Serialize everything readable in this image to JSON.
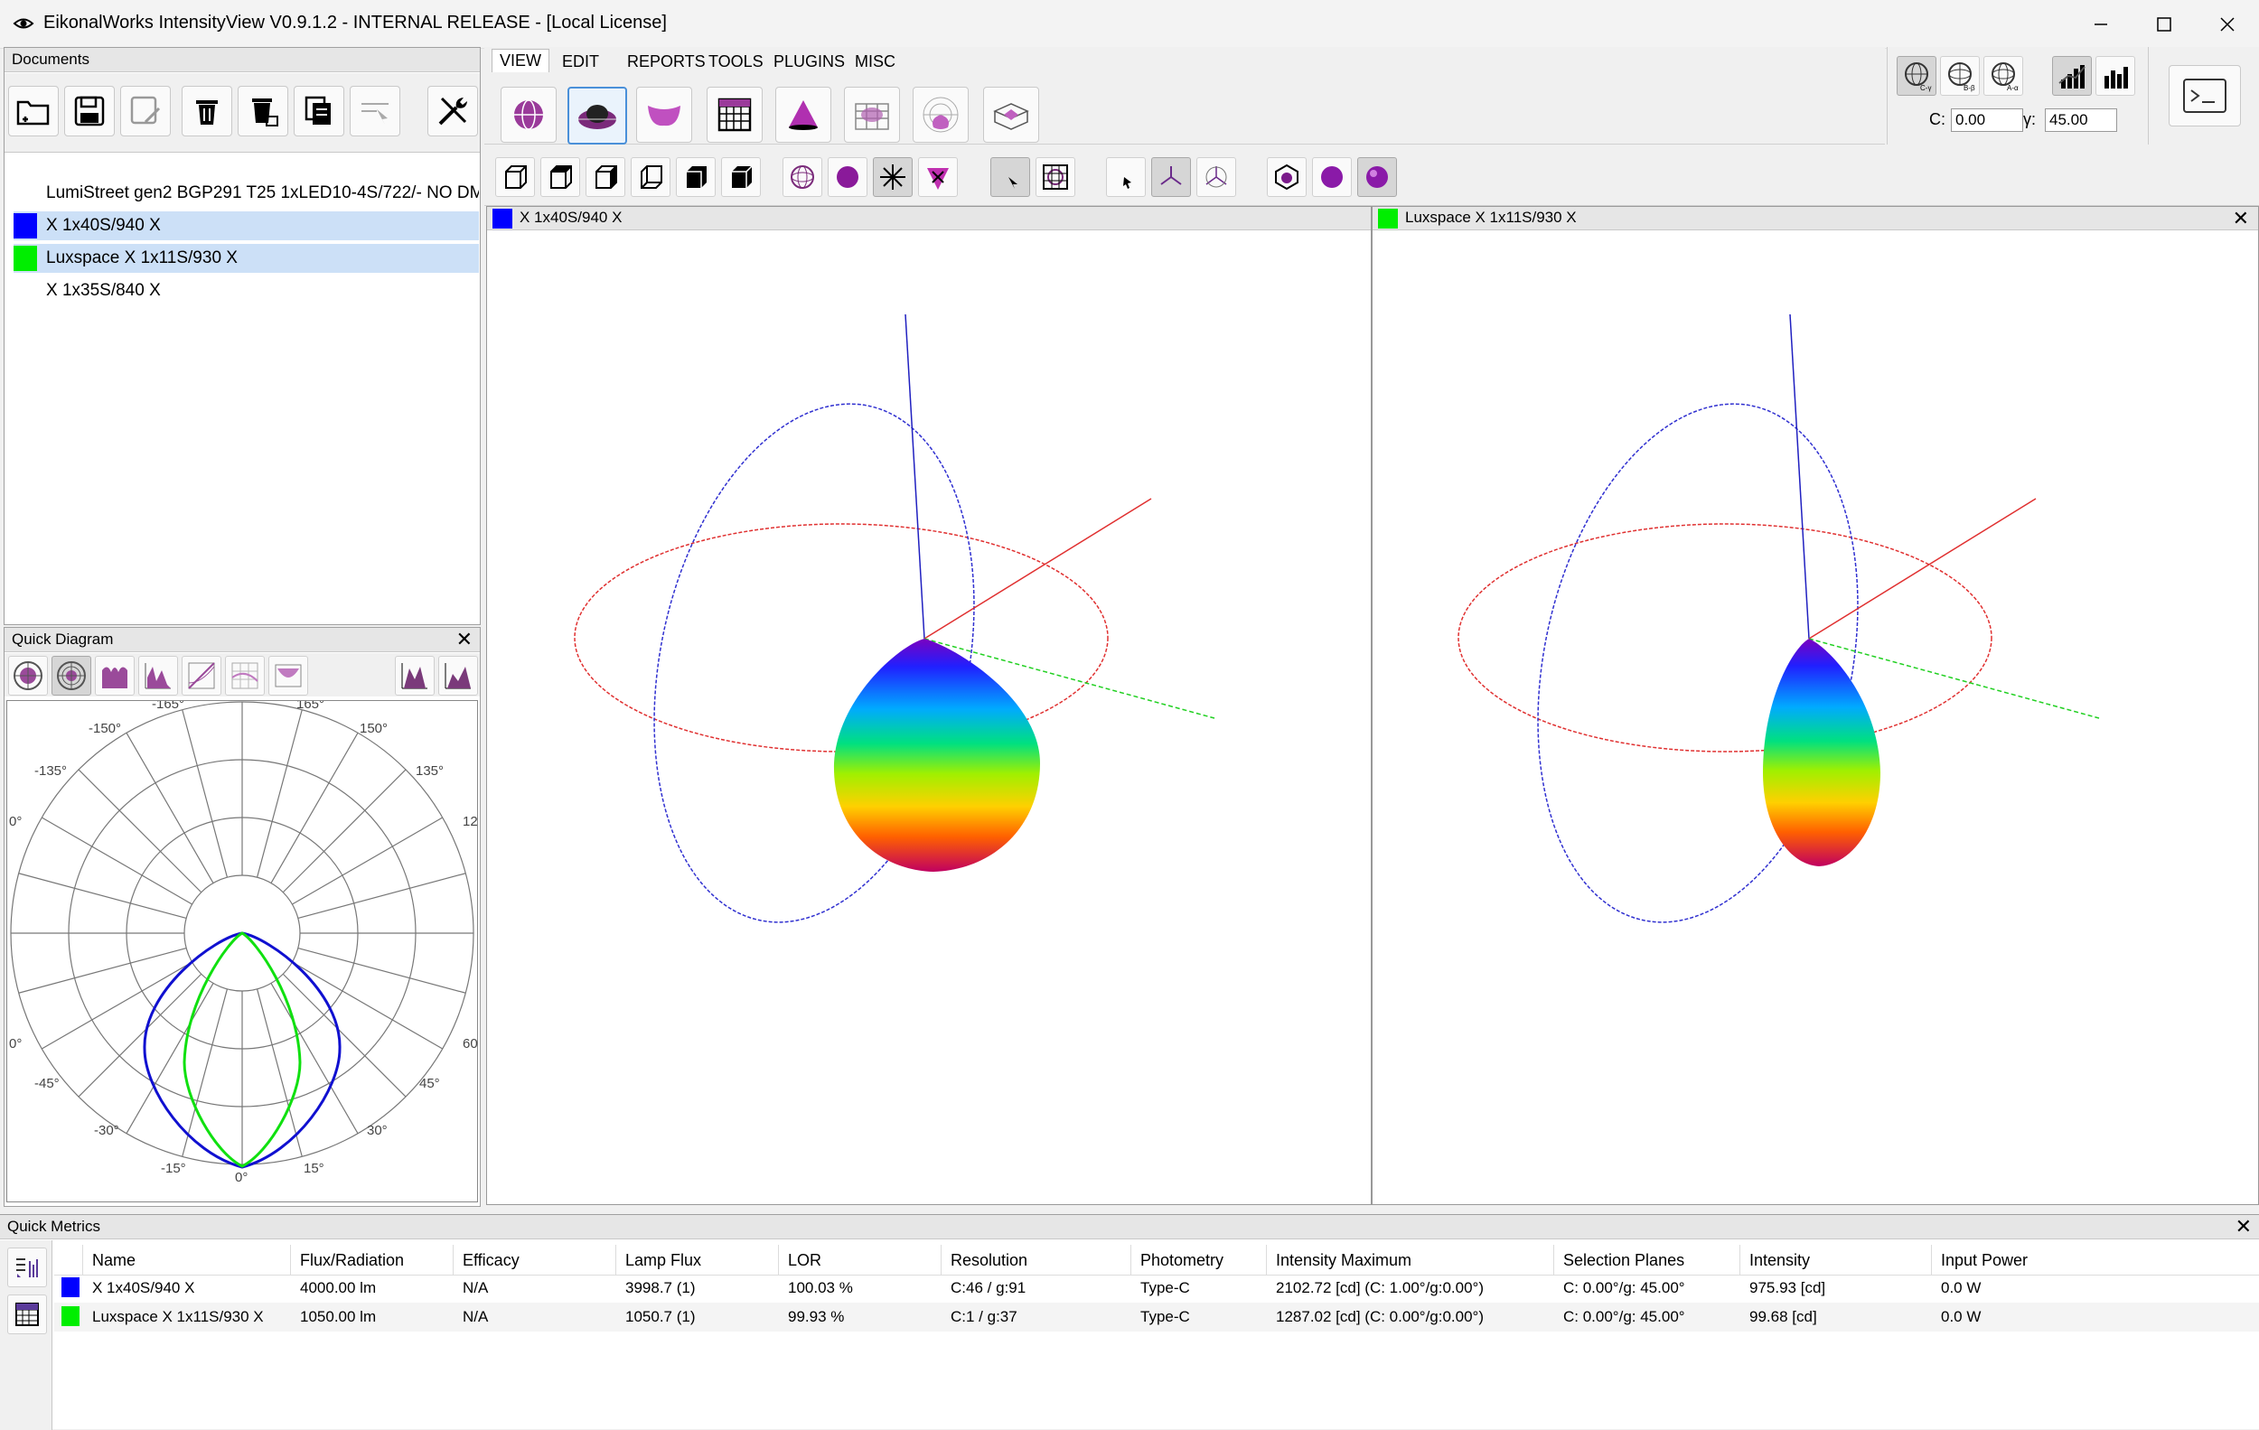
{
  "window": {
    "title": "EikonalWorks IntensityView V0.9.1.2 - INTERNAL RELEASE - [Local License]"
  },
  "documents": {
    "header": "Documents",
    "items": [
      {
        "label": "LumiStreet gen2 BGP291 T25 1xLED10-4S/722/- NO DM",
        "color": null,
        "selected": false
      },
      {
        "label": "X 1x40S/940 X",
        "color": "#0000ff",
        "selected": true
      },
      {
        "label": "Luxspace X 1x11S/930 X",
        "color": "#00ee00",
        "selected": true
      },
      {
        "label": "X 1x35S/840 X",
        "color": null,
        "selected": false
      }
    ]
  },
  "menu": {
    "items": [
      "VIEW",
      "EDIT",
      "REPORTS",
      "TOOLS",
      "PLUGINS",
      "MISC"
    ],
    "active": "VIEW"
  },
  "coords": {
    "c_label": "C:",
    "c_value": "0.00",
    "gamma_label": "γ:",
    "gamma_value": "45.00"
  },
  "quick_diagram": {
    "header": "Quick Diagram",
    "angle_labels": [
      "-165°",
      "165°",
      "-150°",
      "150°",
      "-135°",
      "135°",
      "0°",
      "12",
      "0°",
      "60",
      "-45°",
      "45°",
      "-30°",
      "30°",
      "-15°",
      "15°",
      "0°"
    ]
  },
  "viewports": [
    {
      "title": "X 1x40S/940 X",
      "color": "#0000ff"
    },
    {
      "title": "Luxspace X 1x11S/930 X",
      "color": "#00ee00"
    }
  ],
  "quick_metrics": {
    "header": "Quick Metrics",
    "columns": [
      "Name",
      "Flux/Radiation",
      "Efficacy",
      "Lamp Flux",
      "LOR",
      "Resolution",
      "Photometry",
      "Intensity Maximum",
      "Selection Planes",
      "Intensity",
      "Input Power"
    ],
    "rows": [
      {
        "color": "#0000ff",
        "cells": [
          "X 1x40S/940 X",
          "4000.00 lm",
          "N/A",
          "3998.7 (1)",
          "100.03 %",
          "C:46 / g:91",
          "Type-C",
          "2102.72 [cd] (C: 1.00°/g:0.00°)",
          "C: 0.00°/g: 45.00°",
          "975.93 [cd]",
          "0.0 W"
        ]
      },
      {
        "color": "#00ee00",
        "cells": [
          "Luxspace X 1x11S/930 X",
          "1050.00 lm",
          "N/A",
          "1050.7 (1)",
          "99.93 %",
          "C:1 / g:37",
          "Type-C",
          "1287.02 [cd] (C: 0.00°/g:0.00°)",
          "C: 0.00°/g: 45.00°",
          "99.68 [cd]",
          "0.0 W"
        ]
      }
    ]
  }
}
